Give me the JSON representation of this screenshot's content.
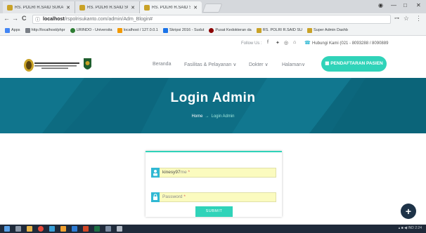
{
  "browser": {
    "tabs": [
      {
        "label": "RS. POLRI R.SAID SUKAN"
      },
      {
        "label": "RS. POLRI R.SAID SUKAN"
      },
      {
        "label": "RS. POLRI R.SAID SUKAN"
      }
    ],
    "window_controls": {
      "profile": "◉",
      "minimize": "—",
      "maximize": "□",
      "close": "✕"
    },
    "nav": {
      "back": "←",
      "forward": "→",
      "reload": "C"
    },
    "address": {
      "host": "localhost",
      "path": "/rspolrisukanto.com/admin/Adm_Blogin#"
    },
    "bookmarks": [
      {
        "label": "Apps",
        "color": "#4285f4"
      },
      {
        "label": "http://localhost/phpr",
        "color": "#7a7f86"
      },
      {
        "label": "URINDO - Universita",
        "color": "#2e7d32"
      },
      {
        "label": "localhost / 127.0.0.1",
        "color": "#f29900"
      },
      {
        "label": "Skripsi 2016 - Sudut",
        "color": "#1a73e8"
      },
      {
        "label": "Pusat Kedokteran da",
        "color": "#8b0000"
      },
      {
        "label": "RS. POLRI R.SAID SU",
        "color": "#c9a227"
      },
      {
        "label": "Super Admin Dashb",
        "color": "#c9a227"
      }
    ]
  },
  "site": {
    "utility": {
      "follow_label": "Follow Us :",
      "social": [
        "f",
        "✦",
        "◎",
        "⌂"
      ],
      "phone_icon": "☎",
      "contact": "Hubungi Kami (021 - 8093288 / 8090889"
    },
    "nav": {
      "items": [
        "Beranda",
        "Fasilitas & Pelayanan ∨",
        "Dokter ∨",
        "Halaman∨"
      ],
      "cta": "PENDAFTARAN PASIEN",
      "cta_icon": "▦"
    },
    "hero": {
      "title": "Login Admin",
      "crumb_home": "Home",
      "crumb_sep": "→",
      "crumb_current": "Login Admin"
    },
    "login": {
      "username_value": "kinesy97",
      "username_placeholder": "me",
      "password_placeholder": "Password",
      "required_mark": "*",
      "submit": "SUBMIT"
    },
    "fab": "+"
  },
  "taskbar": {
    "tray": "▴ ■ ◀ IND  2:24"
  }
}
